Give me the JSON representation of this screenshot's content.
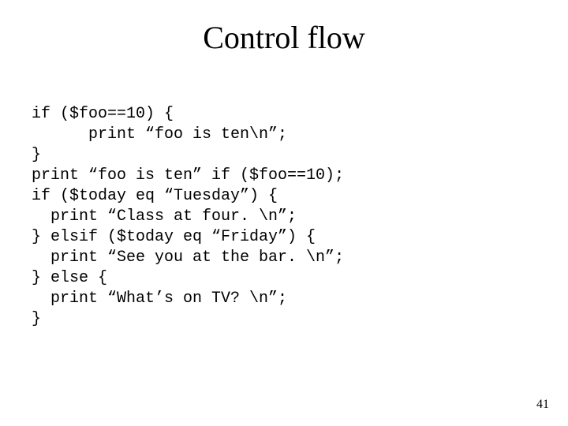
{
  "title": "Control flow",
  "code_lines": [
    "if ($foo==10) {",
    "      print “foo is ten\\n”;",
    "}",
    "print “foo is ten” if ($foo==10);",
    "if ($today eq “Tuesday”) {",
    "  print “Class at four. \\n”;",
    "} elsif ($today eq “Friday”) {",
    "  print “See you at the bar. \\n”;",
    "} else {",
    "  print “What’s on TV? \\n”;",
    "}"
  ],
  "page_number": "41"
}
